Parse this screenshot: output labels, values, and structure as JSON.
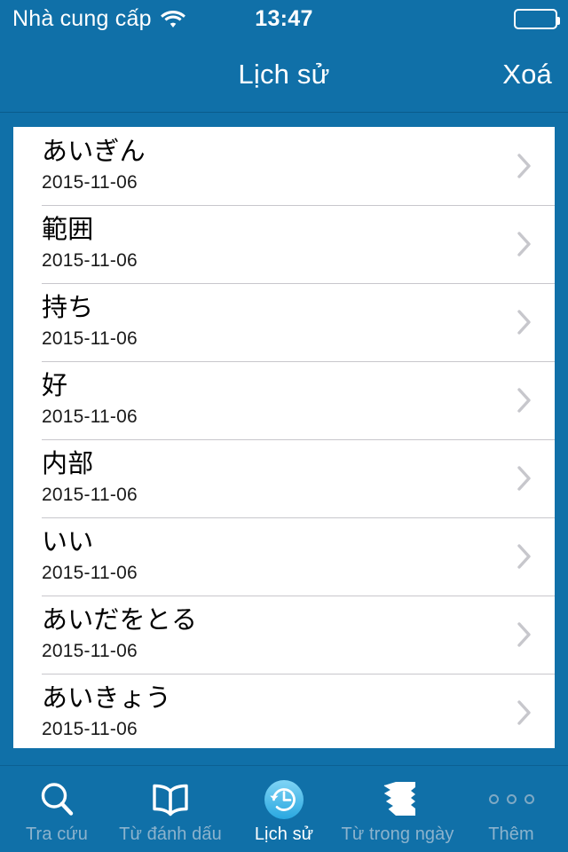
{
  "status_bar": {
    "carrier": "Nhà cung cấp",
    "wifi_icon": "wifi-icon",
    "time": "13:47",
    "battery_icon": "battery-icon",
    "battery_level_percent": 0
  },
  "nav_bar": {
    "title": "Lịch sử",
    "right_action": "Xoá"
  },
  "theme": {
    "background_blue": "#1070a8",
    "card_white": "#ffffff",
    "divider": "#c8c7cc",
    "chevron": "#c7c7cc",
    "tab_inactive": "#8cb3cd",
    "tab_active": "#ffffff",
    "active_icon_top": "#7fd4f5",
    "active_icon_bottom": "#29a8e0"
  },
  "history_list": {
    "items": [
      {
        "term": "あいぎん",
        "date": "2015-11-06",
        "chevron_icon": "chevron-right-icon"
      },
      {
        "term": "範囲",
        "date": "2015-11-06",
        "chevron_icon": "chevron-right-icon"
      },
      {
        "term": "持ち",
        "date": "2015-11-06",
        "chevron_icon": "chevron-right-icon"
      },
      {
        "term": "好",
        "date": "2015-11-06",
        "chevron_icon": "chevron-right-icon"
      },
      {
        "term": "内部",
        "date": "2015-11-06",
        "chevron_icon": "chevron-right-icon"
      },
      {
        "term": "いい",
        "date": "2015-11-06",
        "chevron_icon": "chevron-right-icon"
      },
      {
        "term": "あいだをとる",
        "date": "2015-11-06",
        "chevron_icon": "chevron-right-icon"
      },
      {
        "term": "あいきょう",
        "date": "2015-11-06",
        "chevron_icon": "chevron-right-icon"
      }
    ]
  },
  "tab_bar": {
    "items": [
      {
        "label": "Tra cứu",
        "icon": "search-icon",
        "active": false
      },
      {
        "label": "Từ đánh dấu",
        "icon": "book-icon",
        "active": false
      },
      {
        "label": "Lịch sử",
        "icon": "history-clock-icon",
        "active": true
      },
      {
        "label": "Từ trong ngày",
        "icon": "stacked-cards-icon",
        "active": false
      },
      {
        "label": "Thêm",
        "icon": "more-dots-icon",
        "active": false
      }
    ]
  }
}
